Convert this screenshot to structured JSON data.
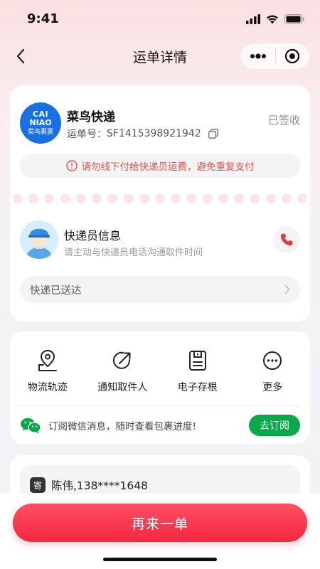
{
  "status_bar": {
    "time": "9:41"
  },
  "nav": {
    "title": "运单详情"
  },
  "package": {
    "logo_line1": "CAI",
    "logo_line2": "NIAO",
    "logo_line3": "菜鸟裹裹",
    "company": "菜鸟快递",
    "waybill_label": "运单号：",
    "waybill_number": "SF1415398921942",
    "status": "已签收",
    "warning": "请勿线下付给快递员运费，避免重复支付"
  },
  "courier": {
    "title": "快递员信息",
    "subtitle": "请主动与快递员电话沟通取件时间",
    "delivery_status": "快递已送达"
  },
  "actions": [
    {
      "label": "物流轨迹",
      "icon": "location-route-icon"
    },
    {
      "label": "通知取件人",
      "icon": "share-arrow-icon"
    },
    {
      "label": "电子存根",
      "icon": "document-save-icon"
    },
    {
      "label": "更多",
      "icon": "more-dots-icon"
    }
  ],
  "subscribe": {
    "text": "订阅微信消息，随时查看包裹进度!",
    "button": "去订阅"
  },
  "sender": {
    "badge": "寄",
    "info": "陈伟,138****1648"
  },
  "cta": {
    "label": "再来一单"
  },
  "colors": {
    "accent": "#f5273f",
    "warning": "#e4544c",
    "wechat_green": "#0aa84a",
    "cainiao_blue": "#1770e6"
  }
}
